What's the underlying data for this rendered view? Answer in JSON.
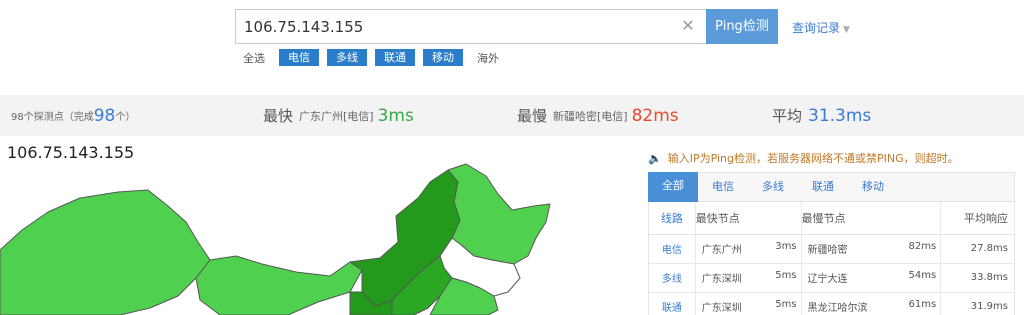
{
  "search": {
    "value": "106.75.143.155",
    "clear_icon": "close-icon",
    "button_label": "Ping检测",
    "history_label": "查询记录"
  },
  "filters": {
    "all": "全选",
    "chips": [
      "电信",
      "多线",
      "联通",
      "移动"
    ],
    "overseas": "海外"
  },
  "stats": {
    "probe_prefix": "98个探测点（完成",
    "probe_done": "98",
    "probe_suffix": "个）",
    "fastest_label": "最快",
    "fastest_loc": "广东广州[电信]",
    "fastest_val": "3ms",
    "slowest_label": "最慢",
    "slowest_loc": "新疆哈密[电信]",
    "slowest_val": "82ms",
    "avg_label": "平均",
    "avg_val": "31.3ms"
  },
  "map": {
    "title": "106.75.143.155",
    "colors": {
      "light": "#4fd14f",
      "medium": "#38b82f",
      "dark": "#249a1c",
      "border": "#555555"
    }
  },
  "notice": "输入IP为Ping检测，若服务器网络不通或禁PING，则超时。",
  "tabs": [
    "全部",
    "电信",
    "多线",
    "联通",
    "移动"
  ],
  "table": {
    "headers": [
      "线路",
      "最快节点",
      "最慢节点",
      "平均响应"
    ],
    "rows": [
      {
        "line": "电信",
        "fast_loc": "广东广州",
        "fast_ms": "3ms",
        "slow_loc": "新疆哈密",
        "slow_ms": "82ms",
        "avg": "27.8ms"
      },
      {
        "line": "多线",
        "fast_loc": "广东深圳",
        "fast_ms": "5ms",
        "slow_loc": "辽宁大连",
        "slow_ms": "54ms",
        "avg": "33.8ms"
      },
      {
        "line": "联通",
        "fast_loc": "广东深圳",
        "fast_ms": "5ms",
        "slow_loc": "黑龙江哈尔滨",
        "slow_ms": "61ms",
        "avg": "31.9ms"
      }
    ]
  }
}
